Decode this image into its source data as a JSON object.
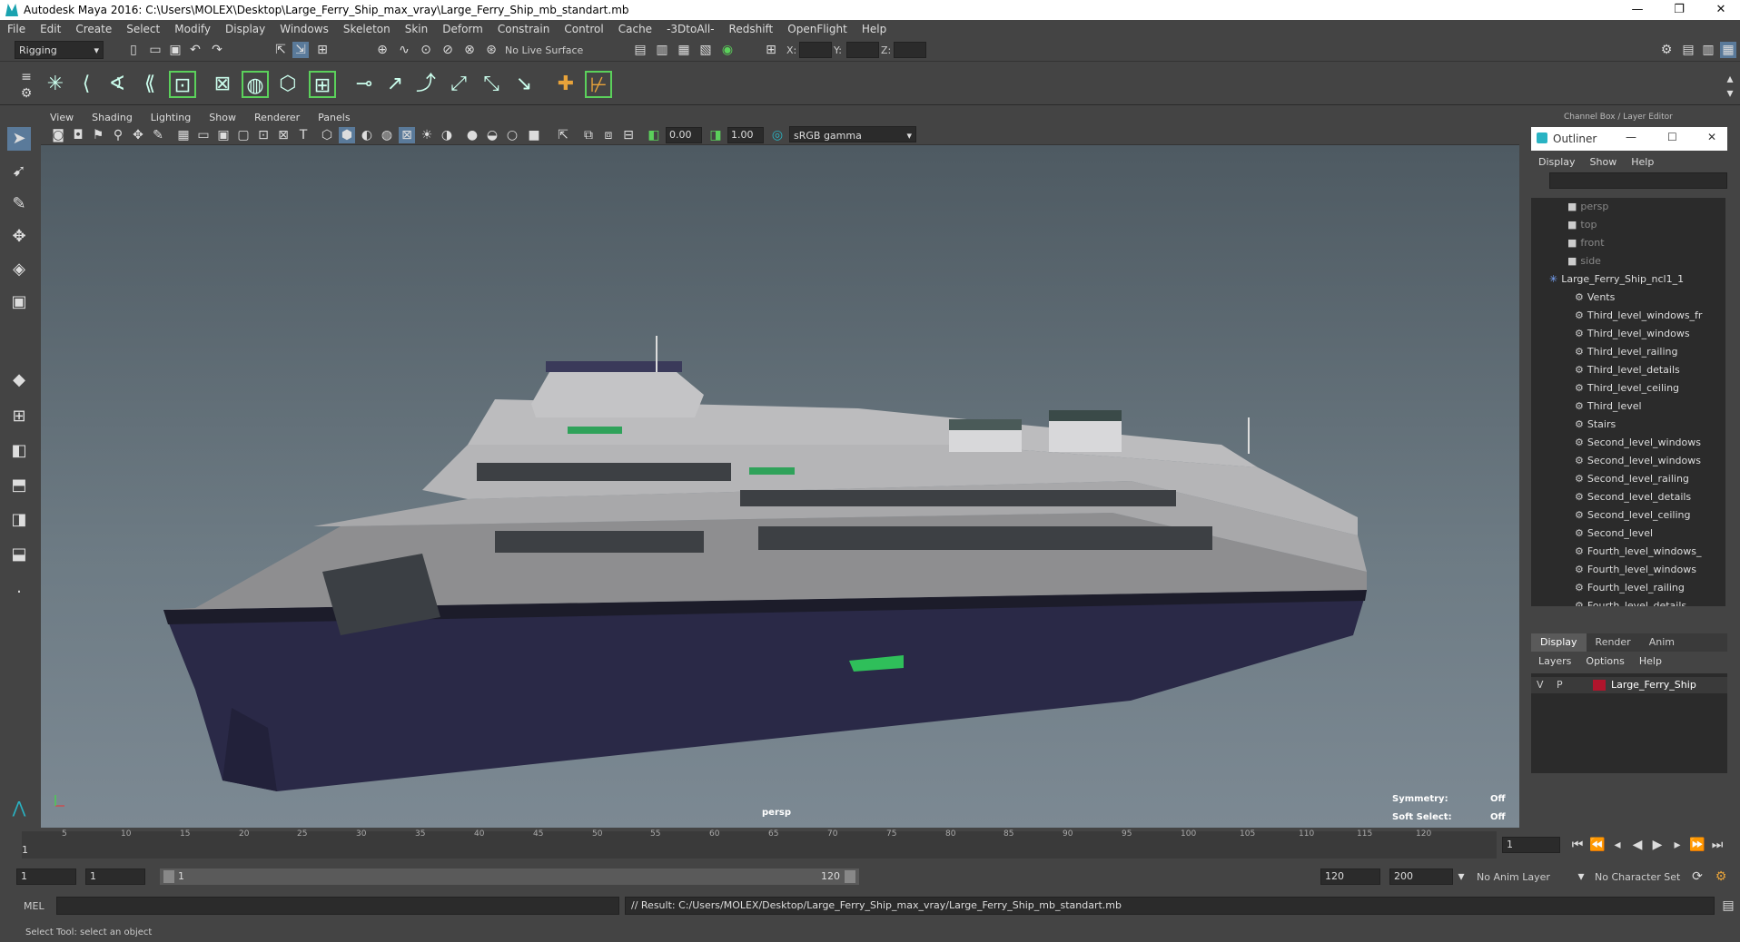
{
  "window": {
    "title": "Autodesk Maya 2016: C:\\Users\\MOLEX\\Desktop\\Large_Ferry_Ship_max_vray\\Large_Ferry_Ship_mb_standart.mb",
    "controls": [
      "—",
      "❐",
      "✕"
    ]
  },
  "menubar": [
    "File",
    "Edit",
    "Create",
    "Select",
    "Modify",
    "Display",
    "Windows",
    "Skeleton",
    "Skin",
    "Deform",
    "Constrain",
    "Control",
    "Cache",
    "-3DtoAll-",
    "Redshift",
    "OpenFlight",
    "Help"
  ],
  "status_line": {
    "menu_set": "Rigging",
    "live_surface": "No Live Surface",
    "x_label": "X:",
    "y_label": "Y:",
    "z_label": "Z:"
  },
  "viewport": {
    "menus": [
      "View",
      "Shading",
      "Lighting",
      "Show",
      "Renderer",
      "Panels"
    ],
    "exposure": "0.00",
    "gamma": "1.00",
    "color_space": "sRGB gamma",
    "camera_label": "persp",
    "symmetry_label": "Symmetry:",
    "symmetry_value": "Off",
    "soft_select_label": "Soft Select:",
    "soft_select_value": "Off"
  },
  "right_panel": {
    "header": "Channel Box / Layer Editor",
    "outliner_title": "Outliner",
    "outliner_menus": [
      "Display",
      "Show",
      "Help"
    ],
    "outliner_items": [
      {
        "label": "persp",
        "dim": true,
        "indent": 0
      },
      {
        "label": "top",
        "dim": true,
        "indent": 0
      },
      {
        "label": "front",
        "dim": true,
        "indent": 0
      },
      {
        "label": "side",
        "dim": true,
        "indent": 0
      },
      {
        "label": "Large_Ferry_Ship_ncl1_1",
        "dim": false,
        "indent": 0,
        "root": true
      },
      {
        "label": "Vents",
        "dim": false,
        "indent": 1
      },
      {
        "label": "Third_level_windows_fr",
        "dim": false,
        "indent": 1
      },
      {
        "label": "Third_level_windows",
        "dim": false,
        "indent": 1
      },
      {
        "label": "Third_level_railing",
        "dim": false,
        "indent": 1
      },
      {
        "label": "Third_level_details",
        "dim": false,
        "indent": 1
      },
      {
        "label": "Third_level_ceiling",
        "dim": false,
        "indent": 1
      },
      {
        "label": "Third_level",
        "dim": false,
        "indent": 1
      },
      {
        "label": "Stairs",
        "dim": false,
        "indent": 1
      },
      {
        "label": "Second_level_windows",
        "dim": false,
        "indent": 1
      },
      {
        "label": "Second_level_windows",
        "dim": false,
        "indent": 1
      },
      {
        "label": "Second_level_railing",
        "dim": false,
        "indent": 1
      },
      {
        "label": "Second_level_details",
        "dim": false,
        "indent": 1
      },
      {
        "label": "Second_level_ceiling",
        "dim": false,
        "indent": 1
      },
      {
        "label": "Second_level",
        "dim": false,
        "indent": 1
      },
      {
        "label": "Fourth_level_windows_",
        "dim": false,
        "indent": 1
      },
      {
        "label": "Fourth_level_windows",
        "dim": false,
        "indent": 1
      },
      {
        "label": "Fourth_level_railing",
        "dim": false,
        "indent": 1
      },
      {
        "label": "Fourth_level_details",
        "dim": false,
        "indent": 1
      }
    ],
    "layer_tabs": [
      "Display",
      "Render",
      "Anim"
    ],
    "layer_menus": [
      "Layers",
      "Options",
      "Help"
    ],
    "layer": {
      "v": "V",
      "p": "P",
      "name": "Large_Ferry_Ship",
      "color": "#b0152c"
    }
  },
  "timeline": {
    "ticks": [
      "5",
      "10",
      "15",
      "20",
      "25",
      "30",
      "35",
      "40",
      "45",
      "50",
      "55",
      "60",
      "65",
      "70",
      "75",
      "80",
      "85",
      "90",
      "95",
      "100",
      "105",
      "110",
      "115",
      "120"
    ],
    "start_marker": "1",
    "current_frame": "1"
  },
  "range": {
    "start": "1",
    "start2": "1",
    "slider_start": "1",
    "slider_end": "120",
    "end": "120",
    "end2": "200",
    "anim_layer": "No Anim Layer",
    "char_set": "No Character Set"
  },
  "command": {
    "lang": "MEL",
    "result": "// Result: C:/Users/MOLEX/Desktop/Large_Ferry_Ship_max_vray/Large_Ferry_Ship_mb_standart.mb"
  },
  "help_line": "Select Tool: select an object"
}
